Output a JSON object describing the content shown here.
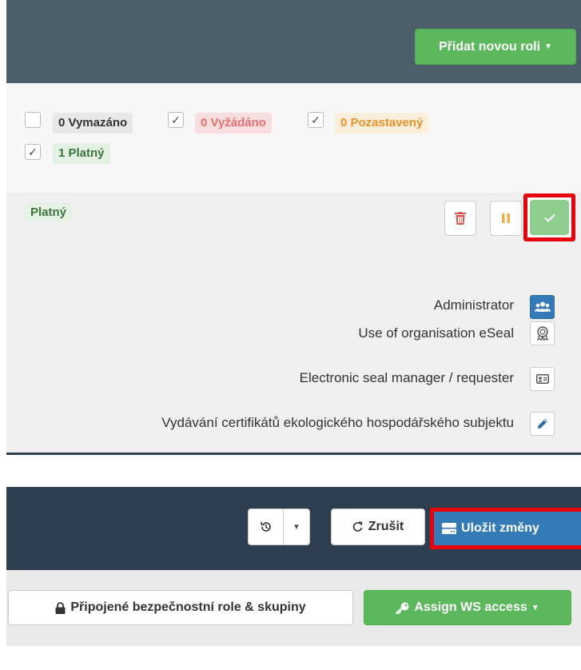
{
  "colors": {
    "header_top": "#4d5e6b",
    "header_bottom": "#2c3e4f",
    "success": "#5cb85c",
    "primary": "#337ab7",
    "danger": "#d9534f",
    "warning": "#f0ad4e",
    "highlight": "#e8000b"
  },
  "top_panel": {
    "add_role_button": "Přidat novou roli",
    "filters": [
      {
        "count_label": "0 Vymazáno",
        "checked": false
      },
      {
        "count_label": "0 Vyžádáno",
        "checked": true
      },
      {
        "count_label": "0 Pozastavený",
        "checked": true
      },
      {
        "count_label": "1 Platný",
        "checked": true
      }
    ],
    "status_badge": "Platný",
    "roles": [
      {
        "label": "Administrator",
        "icon": "users-icon"
      },
      {
        "label": "Use of organisation eSeal",
        "icon": "award-icon"
      },
      {
        "label": "Electronic seal manager / requester",
        "icon": "id-card-icon"
      },
      {
        "label": "Vydávání certifikátů ekologického hospodářského subjektu",
        "icon": "pencil-icon"
      }
    ]
  },
  "bottom_panel": {
    "cancel_button": "Zrušit",
    "save_button": "Uložit změny",
    "security_roles_button": "Připojené bezpečnostní role & skupiny",
    "ws_access_button": "Assign WS access"
  }
}
